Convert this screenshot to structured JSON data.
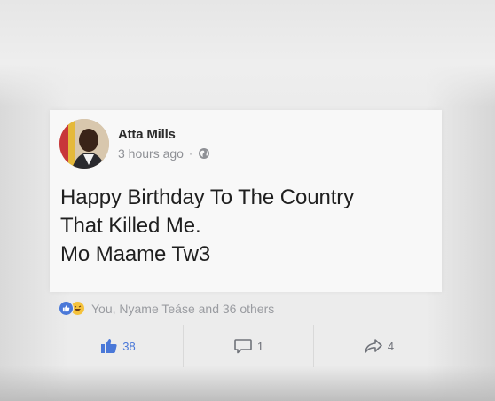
{
  "post": {
    "author_name": "Atta Mills",
    "timestamp": "3 hours ago",
    "separator": "·",
    "privacy_icon": "globe-icon",
    "text_lines": [
      "Happy Birthday To The Country",
      "That Killed Me.",
      "Mo Maame Tw3"
    ]
  },
  "reactions": {
    "icons": [
      "like-reaction-icon",
      "haha-reaction-icon"
    ],
    "summary": "You, Nyame Teáse and 36 others"
  },
  "actions": {
    "like_count": "38",
    "comment_count": "1",
    "share_count": "4"
  },
  "colors": {
    "accent": "#4a78d8",
    "muted_text": "#8f9196",
    "card_background": "#f8f8f8"
  }
}
